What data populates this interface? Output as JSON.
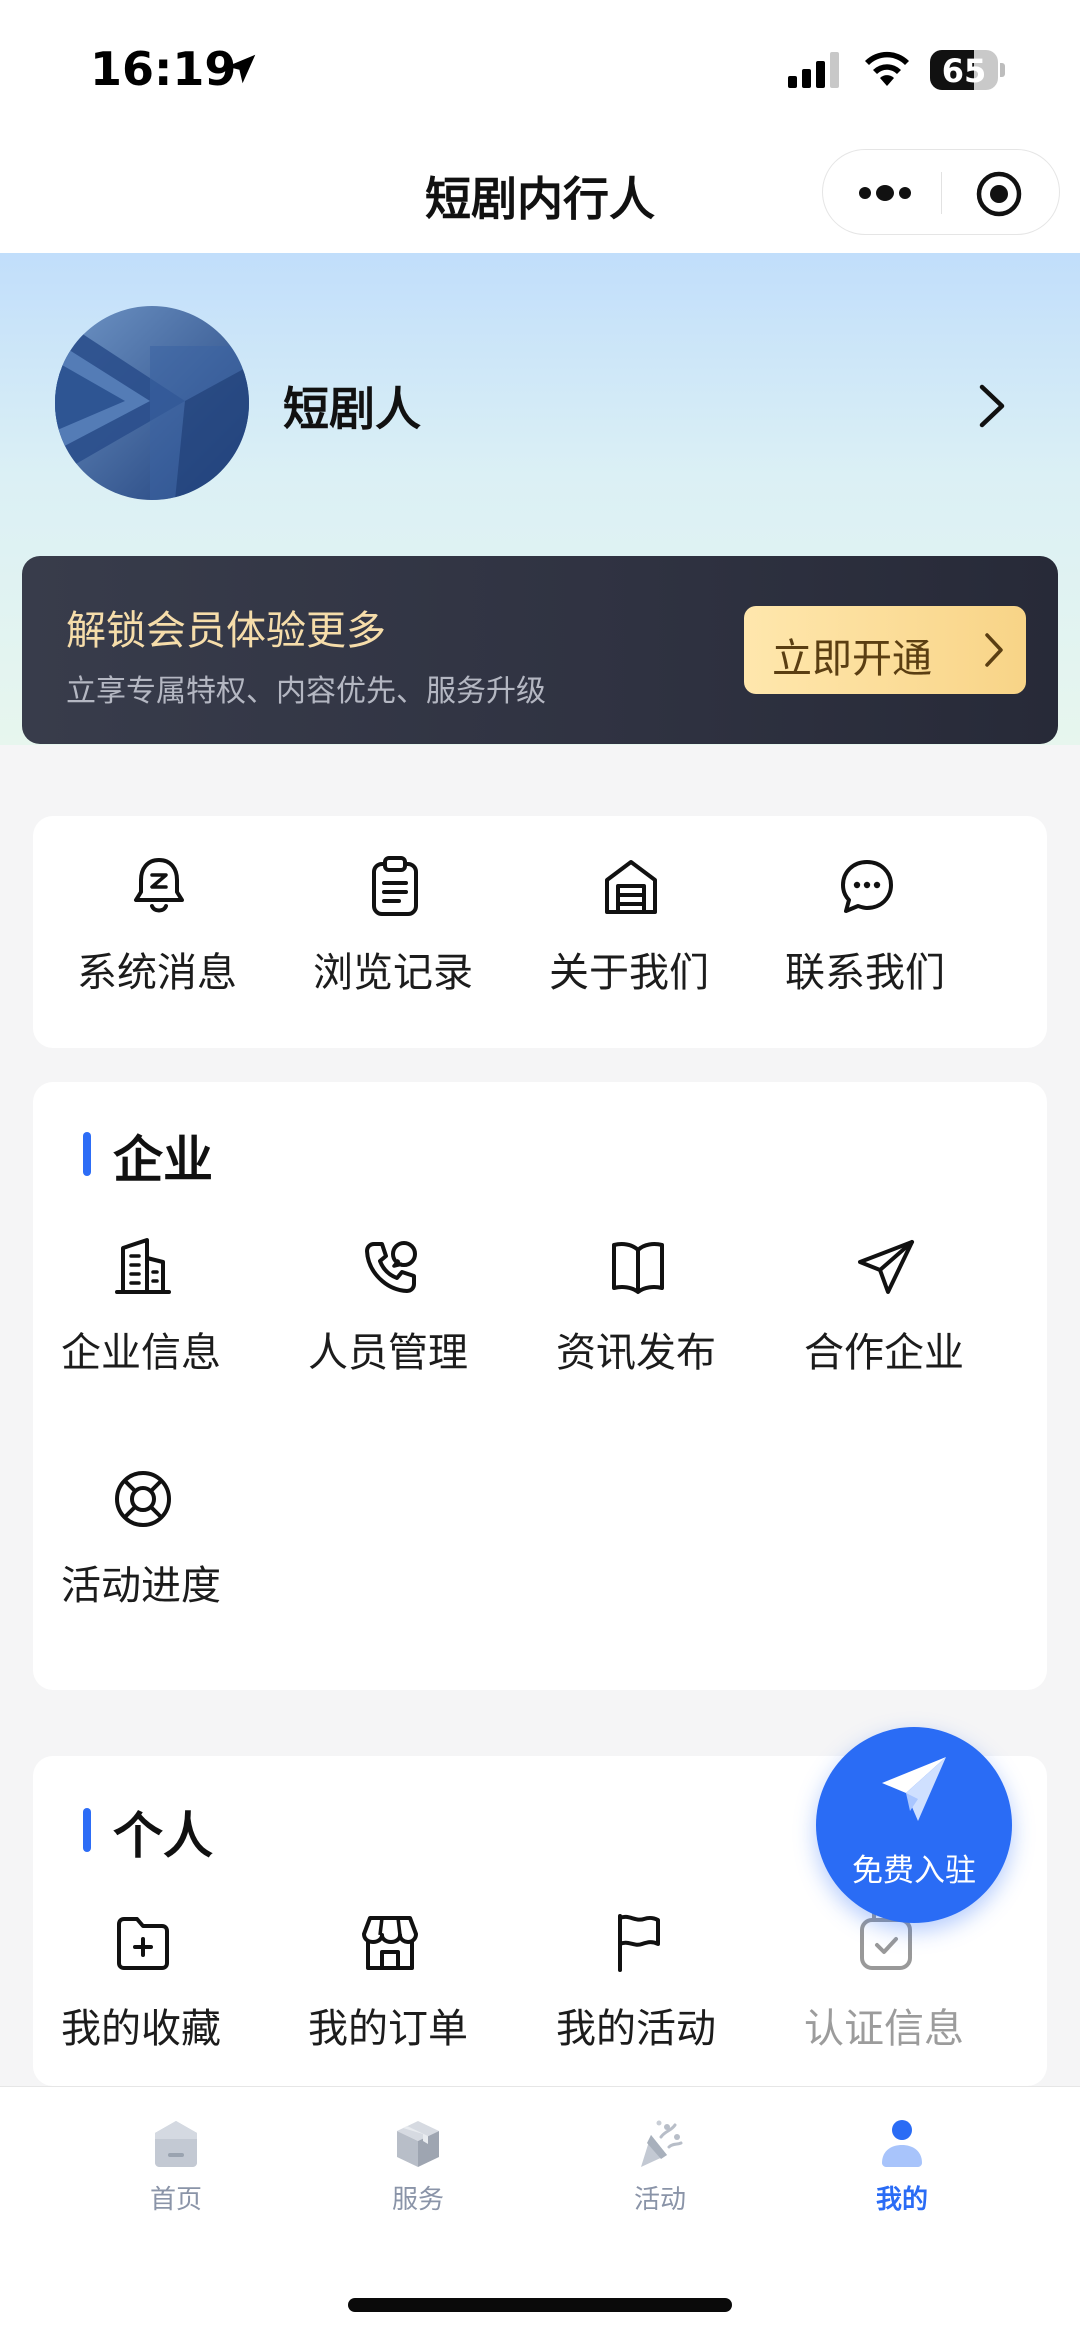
{
  "status_bar": {
    "time": "16:19",
    "battery_level": "65",
    "battery_fraction": 0.65,
    "icons": [
      "location-arrow-icon",
      "signal-icon",
      "wifi-icon",
      "battery-icon"
    ]
  },
  "nav": {
    "title": "短剧内行人",
    "icons": [
      "more-icon",
      "close-target-icon"
    ]
  },
  "profile": {
    "name": "短剧人"
  },
  "vip": {
    "title": "解锁会员体验更多",
    "subtitle": "立享专属特权、内容优先、服务升级",
    "button_label": "立即开通"
  },
  "quick_actions": [
    {
      "label": "系统消息",
      "icon": "bell-icon"
    },
    {
      "label": "浏览记录",
      "icon": "clipboard-icon"
    },
    {
      "label": "关于我们",
      "icon": "building-icon"
    },
    {
      "label": "联系我们",
      "icon": "chat-icon"
    }
  ],
  "enterprise": {
    "title": "企业",
    "items": [
      {
        "label": "企业信息",
        "icon": "office-building-icon"
      },
      {
        "label": "人员管理",
        "icon": "phone-call-icon"
      },
      {
        "label": "资讯发布",
        "icon": "book-open-icon"
      },
      {
        "label": "合作企业",
        "icon": "paper-plane-icon"
      },
      {
        "label": "活动进度",
        "icon": "lifebuoy-icon"
      }
    ]
  },
  "personal": {
    "title": "个人",
    "items": [
      {
        "label": "我的收藏",
        "icon": "folder-plus-icon"
      },
      {
        "label": "我的订单",
        "icon": "store-icon"
      },
      {
        "label": "我的活动",
        "icon": "flag-icon"
      },
      {
        "label": "认证信息",
        "icon": "check-badge-icon"
      }
    ]
  },
  "fab": {
    "label": "免费入驻",
    "icon": "send-icon"
  },
  "tabs": [
    {
      "label": "首页",
      "icon": "home-icon",
      "active": false
    },
    {
      "label": "服务",
      "icon": "box-icon",
      "active": false
    },
    {
      "label": "活动",
      "icon": "party-popper-icon",
      "active": false
    },
    {
      "label": "我的",
      "icon": "user-icon",
      "active": true
    }
  ],
  "colors": {
    "accent": "#2a6cf5",
    "vip_gold": "#f6ddaa",
    "tab_inactive": "#8a94a8"
  }
}
